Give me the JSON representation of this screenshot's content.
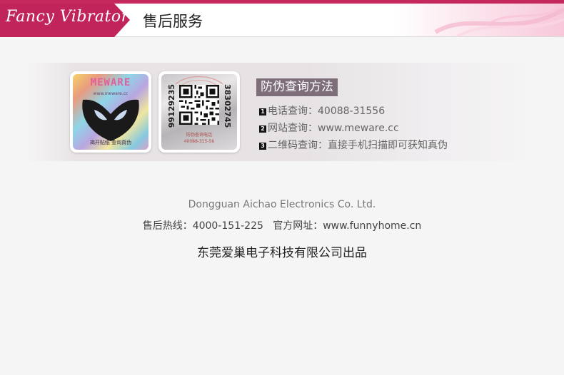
{
  "header": {
    "brand": "Fancy Vibrator",
    "title": "售后服务",
    "accent_color": "#c1245a"
  },
  "labels": {
    "hologram": {
      "brand": "MEWARE",
      "url": "www.meware.cc",
      "bottom_text": "揭开贴纸 查询真伪"
    },
    "security": {
      "code_left": "99129235",
      "code_right": "38302745",
      "line1": "防伪查询电话",
      "line2": "40088-315-56"
    }
  },
  "method": {
    "title": "防伪查询方法",
    "steps": [
      {
        "num": "1",
        "text": "电话查询：40088-31556"
      },
      {
        "num": "2",
        "text": "网站查询：www.meware.cc"
      },
      {
        "num": "3",
        "text": "二维码查询：直接手机扫描即可获知真伪"
      }
    ]
  },
  "footer": {
    "company": "Dongguan Aichao Electronics Co. Ltd.",
    "hotline": "售后热线：4000-151-225   官方网址：www.funnyhome.cn",
    "producer": "东莞爱巢电子科技有限公司出品"
  }
}
